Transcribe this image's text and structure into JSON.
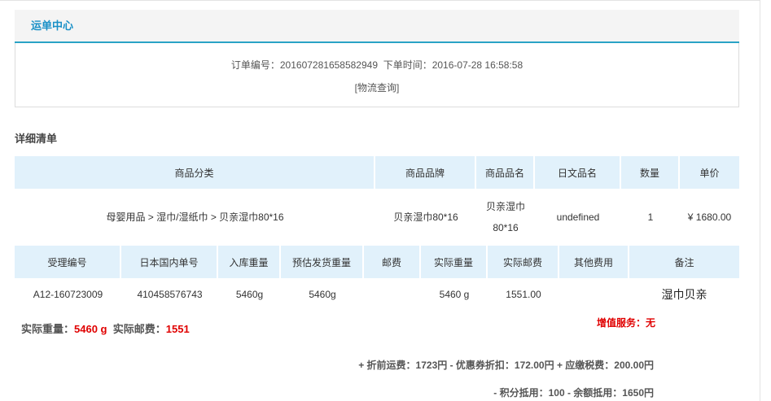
{
  "header": {
    "title": "运单中心"
  },
  "order": {
    "label_no": "订单编号：",
    "number": "201607281658582949",
    "label_time": "下单时间：",
    "time": "2016-07-28 16:58:58",
    "tracking_link": "[物流查询]"
  },
  "detail": {
    "title": "详细清单"
  },
  "goods_table": {
    "headers": [
      "商品分类",
      "商品品牌",
      "商品品名",
      "日文品名",
      "数量",
      "单价"
    ],
    "row": [
      "母婴用品 > 湿巾/湿纸巾 > 贝亲湿巾80*16",
      "贝亲湿巾80*16",
      "贝亲湿巾\n80*16",
      "undefined",
      "1",
      "¥ 1680.00"
    ]
  },
  "shipping_table": {
    "headers": [
      "受理编号",
      "日本国内单号",
      "入库重量",
      "预估发货重量",
      "邮费",
      "实际重量",
      "实际邮费",
      "其他费用",
      "备注"
    ],
    "row": [
      "A12-160723009",
      "410458576743",
      "5460g",
      "5460g",
      "",
      "5460 g",
      "1551.00",
      "",
      "湿巾贝亲"
    ]
  },
  "summary": {
    "weight_label": "实际重量：",
    "weight_value": "5460 g",
    "postage_label": "实际邮费：",
    "postage_value": "1551",
    "value_added": "增值服务：无"
  },
  "fees": {
    "line1": "+ 折前运费：1723円 - 优惠券折扣：172.00円 + 应缴税费：200.00円",
    "line2": "- 积分抵用：100 - 余额抵用：1650円"
  },
  "colors": {
    "accent": "#1990c7",
    "header_bg": "#e1f1fb",
    "alert": "#e00000"
  }
}
